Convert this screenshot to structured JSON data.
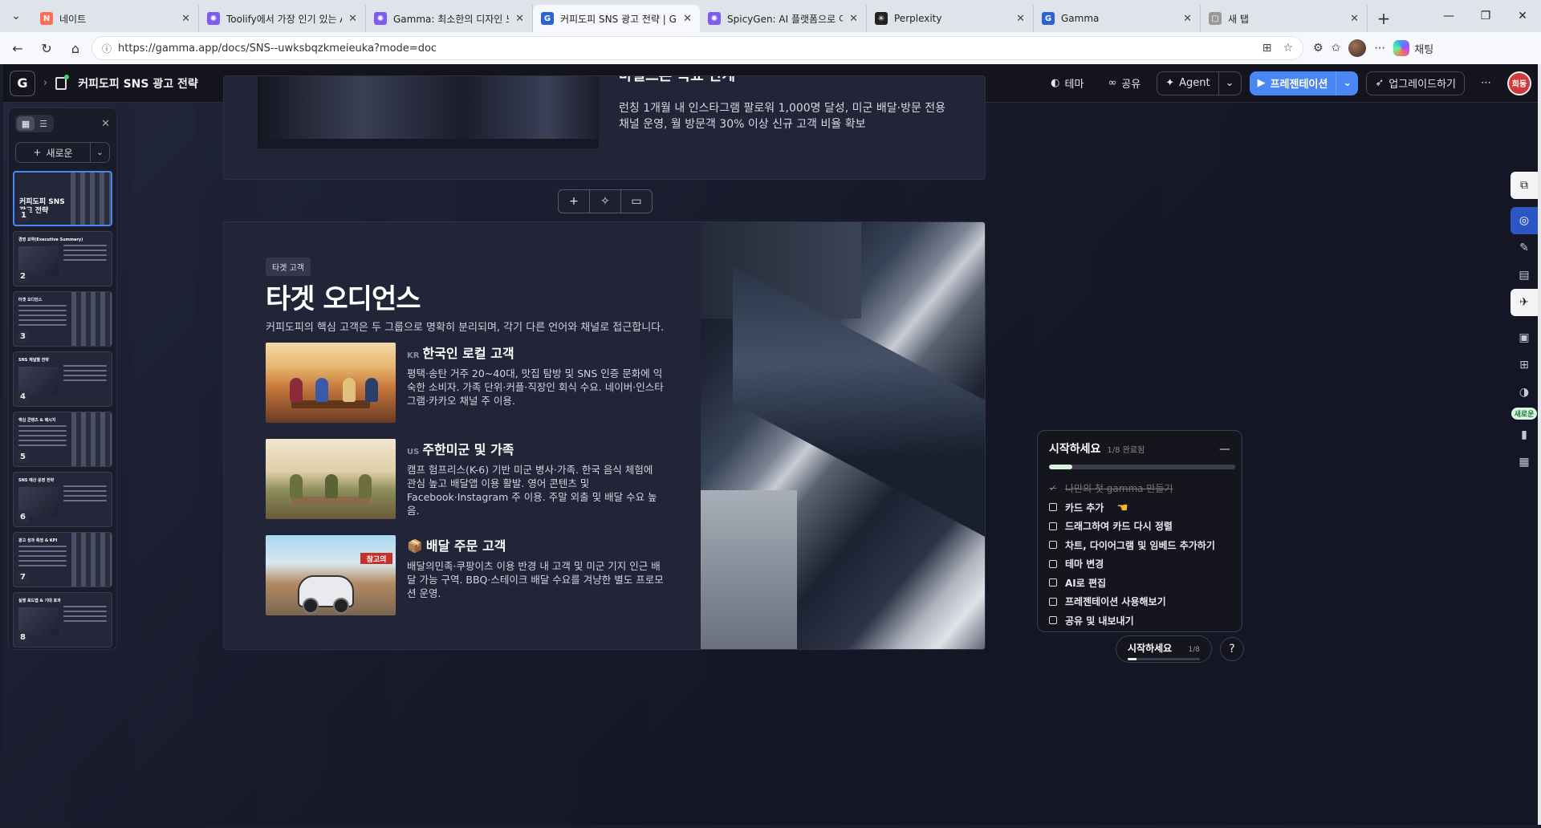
{
  "browser": {
    "tabs": [
      {
        "label": "네이트",
        "favicon": "N",
        "color": "#ff6b57",
        "active": false
      },
      {
        "label": "Toolify에서 가장 인기 있는 A",
        "favicon": "✺",
        "color": "#7a5cf0",
        "active": false
      },
      {
        "label": "Gamma: 최소한의 디자인 노",
        "favicon": "✺",
        "color": "#7a5cf0",
        "active": false
      },
      {
        "label": "커피도피 SNS 광고 전략 | Ga",
        "favicon": "G",
        "color": "#2a63d6",
        "active": true
      },
      {
        "label": "SpicyGen: AI 플랫폼으로 이미",
        "favicon": "✺",
        "color": "#7a5cf0",
        "active": false
      },
      {
        "label": "Perplexity",
        "favicon": "✳",
        "color": "#222",
        "active": false
      },
      {
        "label": "Gamma",
        "favicon": "G",
        "color": "#2a63d6",
        "active": false
      },
      {
        "label": "새 탭",
        "favicon": "▢",
        "color": "#999",
        "active": false
      }
    ],
    "url": "https://gamma.app/docs/SNS--uwksbqzkmeieuka?mode=doc",
    "chat_label": "채팅"
  },
  "topbar": {
    "doc_title": "커피도피 SNS 광고 전략",
    "theme_label": "테마",
    "share_label": "공유",
    "agent_label": "Agent",
    "present_label": "프레젠테이션",
    "upgrade_label": "업그레이드하기",
    "user_initials": "희동"
  },
  "sidebar": {
    "new_label": "새로운",
    "thumbnails": [
      {
        "num": "1",
        "title": "커피도피 SNS\n광고 전략"
      },
      {
        "num": "2",
        "title": "경영 요약(Executive Summary)"
      },
      {
        "num": "3",
        "title": "타겟 오디언스"
      },
      {
        "num": "4",
        "title": "SNS 채널별 전략"
      },
      {
        "num": "5",
        "title": "핵심 콘텐츠 & 메시지"
      },
      {
        "num": "6",
        "title": "SNS 예산 운영 전략"
      },
      {
        "num": "7",
        "title": "광고 성과 측정 & KPI"
      },
      {
        "num": "8",
        "title": "실행 로드맵 & 기대 효과"
      }
    ]
  },
  "card_top": {
    "title": "마일스톤 목표 단계",
    "text": "런칭 1개월 내 인스타그램 팔로워 1,000명 달성, 미군 배달·방문 전용 채널 운영, 월 방문객 30% 이상 신규 고객 비율 확보"
  },
  "card_main": {
    "tag": "타겟 고객",
    "title": "타겟 오디언스",
    "lead": "커피도피의 핵심 고객은 두 그룹으로 명확히 분리되며, 각기 다른 언어와 채널로 접근합니다.",
    "audiences": [
      {
        "code": "KR",
        "title": "한국인 로컬 고객",
        "desc": "평택·송탄 거주 20~40대, 맛집 탐방 및 SNS 인증 문화에 익숙한 소비자. 가족 단위·커플·직장인 회식 수요. 네이버·인스타그램·카카오 채널 주 이용."
      },
      {
        "code": "US",
        "title": "주한미군 및 가족",
        "desc": "캠프 험프리스(K-6) 기반 미군 병사·가족. 한국 음식 체험에 관심 높고 배달앱 이용 활발. 영어 콘텐츠 및 Facebook·Instagram 주 이용. 주말 외출 및 배달 수요 높음."
      },
      {
        "code": "📦",
        "title": "배달 주문 고객",
        "desc": "배달의민족·쿠팡이츠 이용 반경 내 고객 및 미군 기지 인근 배달 가능 구역. BBQ·스테이크 배달 수요를 겨냥한 별도 프로모션 운영."
      }
    ],
    "delivery_sign": "참고의"
  },
  "right_tools": {
    "new_badge": "새로운"
  },
  "getting_started": {
    "title": "시작하세요",
    "progress_text": "1/8 완료됨",
    "progress": 0.125,
    "items": [
      {
        "label": "나만의 첫 gamma 만들기",
        "done": true
      },
      {
        "label": "카드 추가",
        "done": false
      },
      {
        "label": "드래그하여 카드 다시 정렬",
        "done": false
      },
      {
        "label": "차트, 다이어그램 및 임베드 추가하기",
        "done": false
      },
      {
        "label": "테마 변경",
        "done": false
      },
      {
        "label": "AI로 편집",
        "done": false
      },
      {
        "label": "프레젠테이션 사용해보기",
        "done": false
      },
      {
        "label": "공유 및 내보내기",
        "done": false
      }
    ],
    "mini_label": "시작하세요",
    "mini_count": "1/8"
  }
}
